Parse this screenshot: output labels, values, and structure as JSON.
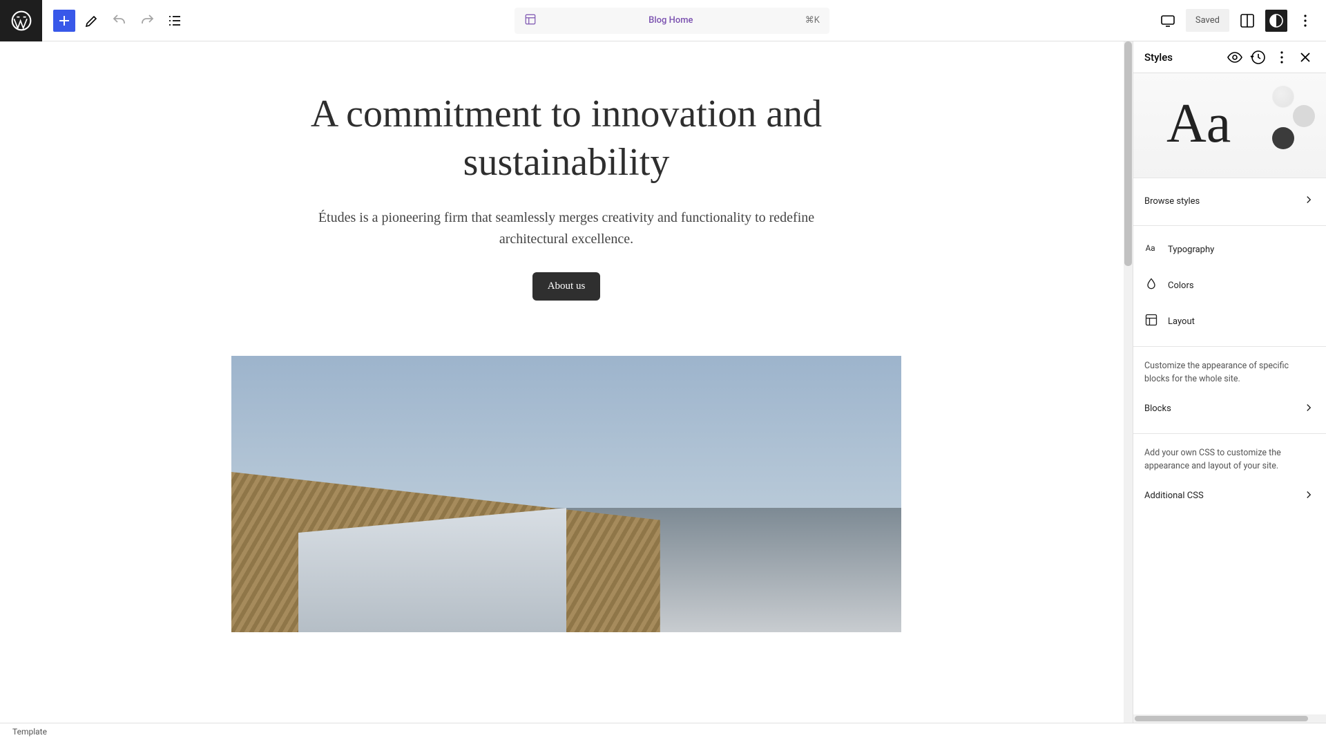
{
  "colors": {
    "accent": "#3858e9",
    "breadcrumb": "#7b52b0",
    "toolbar_dark": "#1e1e1e"
  },
  "top": {
    "breadcrumb_title": "Blog Home",
    "shortcut": "⌘K",
    "saved_label": "Saved"
  },
  "canvas": {
    "hero_title": "A commitment to innovation and sustainability",
    "hero_desc": "Études is a pioneering firm that seamlessly merges creativity and functionality to redefine architectural excellence.",
    "hero_button": "About us"
  },
  "sidebar": {
    "title": "Styles",
    "preview_sample": "Aa",
    "rows": {
      "browse": "Browse styles",
      "typography": "Typography",
      "colors": "Colors",
      "layout": "Layout",
      "blocks": "Blocks",
      "additional_css": "Additional CSS"
    },
    "blocks_desc": "Customize the appearance of specific blocks for the whole site.",
    "css_desc": "Add your own CSS to customize the appearance and layout of your site."
  },
  "footer": {
    "status": "Template"
  }
}
